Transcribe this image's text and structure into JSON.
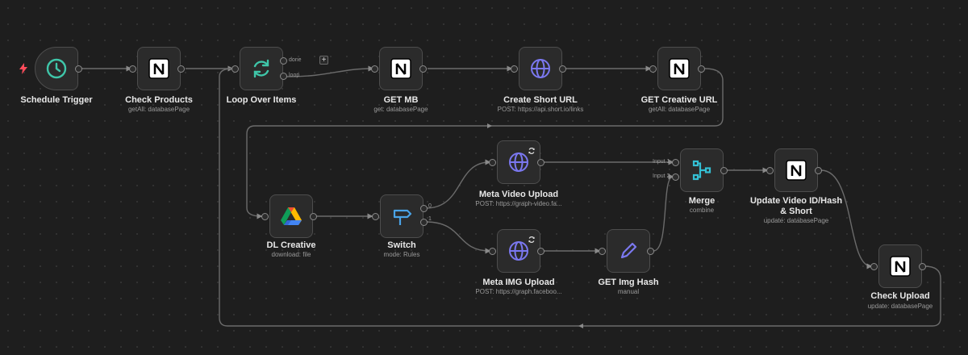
{
  "nodes": {
    "schedule_trigger": {
      "label": "Schedule Trigger",
      "sub": ""
    },
    "check_products": {
      "label": "Check Products",
      "sub": "getAll: databasePage"
    },
    "loop_over_items": {
      "label": "Loop Over Items",
      "sub": "",
      "out_done": "done",
      "out_loop": "loop"
    },
    "get_mb": {
      "label": "GET MB",
      "sub": "get: databasePage"
    },
    "create_short_url": {
      "label": "Create Short URL",
      "sub": "POST: https://api.short.io/links"
    },
    "get_creative_url": {
      "label": "GET Creative URL",
      "sub": "getAll: databasePage"
    },
    "dl_creative": {
      "label": "DL Creative",
      "sub": "download: file"
    },
    "switch": {
      "label": "Switch",
      "sub": "mode: Rules",
      "out_0": "0",
      "out_1": "1"
    },
    "meta_video_upload": {
      "label": "Meta Video Upload",
      "sub": "POST: https://graph-video.fa..."
    },
    "meta_img_upload": {
      "label": "Meta IMG Upload",
      "sub": "POST: https://graph.faceboo..."
    },
    "get_img_hash": {
      "label": "GET Img Hash",
      "sub": "manual"
    },
    "merge": {
      "label": "Merge",
      "sub": "combine",
      "in_1": "Input 1",
      "in_2": "Input 2"
    },
    "update_video": {
      "label": "Update Video ID/Hash & Short",
      "sub": "update: databasePage"
    },
    "check_upload": {
      "label": "Check Upload",
      "sub": "update: databasePage"
    }
  },
  "plus_symbol": "+",
  "colors": {
    "canvas_bg": "#1e1e1e",
    "node_bg": "#2b2b2b",
    "wire": "#6b6b6b",
    "trigger_teal": "#3fc6a9",
    "globe_purple": "#7b78f0",
    "switch_blue": "#4aa3e6",
    "merge_cyan": "#34bfd3",
    "bolt_red": "#ff4c5b"
  },
  "icons": {
    "schedule_trigger": "clock-icon",
    "check_products": "notion-icon",
    "loop_over_items": "refresh-icon",
    "get_mb": "notion-icon",
    "create_short_url": "globe-icon",
    "get_creative_url": "notion-icon",
    "dl_creative": "google-drive-icon",
    "switch": "signpost-icon",
    "meta_video_upload": "globe-icon",
    "meta_img_upload": "globe-icon",
    "get_img_hash": "pencil-icon",
    "merge": "merge-icon",
    "update_video": "notion-icon",
    "check_upload": "notion-icon"
  }
}
